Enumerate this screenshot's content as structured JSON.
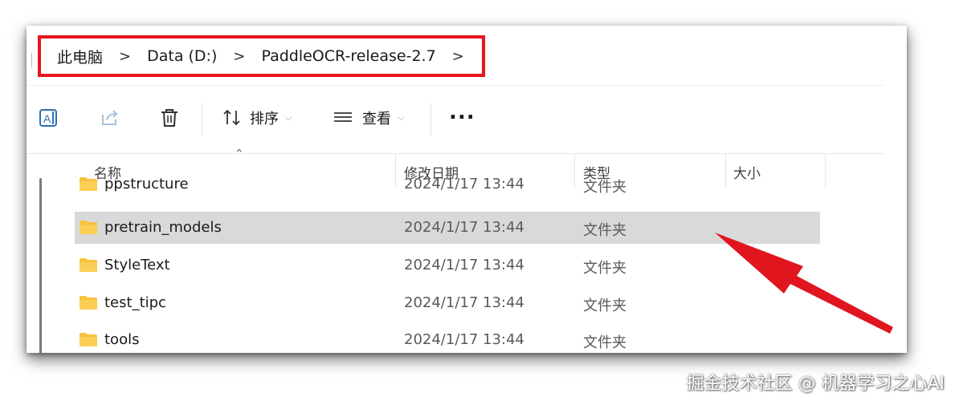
{
  "breadcrumb": {
    "items": [
      "此电脑",
      "Data (D:)",
      "PaddleOCR-release-2.7"
    ],
    "separator": ">",
    "trailing_chevron": ">"
  },
  "toolbar": {
    "sort_label": "排序",
    "view_label": "查看",
    "more_label": "...",
    "icons": [
      "rename-icon",
      "share-icon",
      "delete-icon",
      "sort-icon",
      "view-icon",
      "more-icon"
    ]
  },
  "columns": {
    "name": "名称",
    "modified": "修改日期",
    "type": "类型",
    "size": "大小"
  },
  "files": [
    {
      "name": "ppstructure",
      "modified": "2024/1/17 13:44",
      "type": "文件夹",
      "selected": false
    },
    {
      "name": "pretrain_models",
      "modified": "2024/1/17 13:44",
      "type": "文件夹",
      "selected": true
    },
    {
      "name": "StyleText",
      "modified": "2024/1/17 13:44",
      "type": "文件夹",
      "selected": false
    },
    {
      "name": "test_tipc",
      "modified": "2024/1/17 13:44",
      "type": "文件夹",
      "selected": false
    },
    {
      "name": "tools",
      "modified": "2024/1/17 13:44",
      "type": "文件夹",
      "selected": false
    }
  ],
  "watermark": "掘金技术社区 @ 机器学习之心AI",
  "colors": {
    "highlight_box": "#e8141c",
    "arrow": "#e0151e",
    "selected_row": "#d9d9d9",
    "folder": "#f8c13e"
  }
}
